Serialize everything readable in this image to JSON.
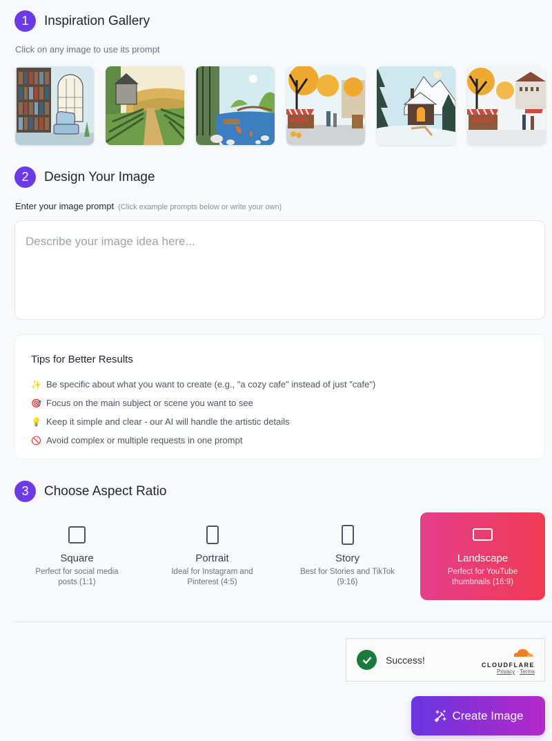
{
  "sections": {
    "gallery": {
      "step": "1",
      "title": "Inspiration Gallery",
      "hint": "Click on any image to use its prompt"
    },
    "design": {
      "step": "2",
      "title": "Design Your Image"
    },
    "aspect": {
      "step": "3",
      "title": "Choose Aspect Ratio"
    }
  },
  "gallery": {
    "images": [
      {
        "name": "library-reading-nook",
        "alt": "Cozy library with arched window and armchair"
      },
      {
        "name": "vineyard-cottage",
        "alt": "Stone cottage beside vineyard rows and hills"
      },
      {
        "name": "koi-pond-garden",
        "alt": "Japanese garden with koi pond and bridge"
      },
      {
        "name": "autumn-market",
        "alt": "Autumn street market with produce stalls"
      },
      {
        "name": "snowy-cabin",
        "alt": "Snowy mountain cabin with glowing window"
      },
      {
        "name": "winter-market",
        "alt": "Town square market in late autumn"
      }
    ]
  },
  "prompt": {
    "label": "Enter your image prompt",
    "sublabel": "(Click example prompts below or write your own)",
    "placeholder": "Describe your image idea here...",
    "value": ""
  },
  "tips": {
    "title": "Tips for Better Results",
    "items": [
      {
        "icon": "sparkles-icon",
        "glyph": "✨",
        "text": "Be specific about what you want to create (e.g., \"a cozy cafe\" instead of just \"cafe\")"
      },
      {
        "icon": "target-icon",
        "glyph": "🎯",
        "text": "Focus on the main subject or scene you want to see"
      },
      {
        "icon": "lightbulb-icon",
        "glyph": "💡",
        "text": "Keep it simple and clear - our AI will handle the artistic details"
      },
      {
        "icon": "prohibited-icon",
        "glyph": "🚫",
        "text": "Avoid complex or multiple requests in one prompt"
      }
    ]
  },
  "aspect_ratios": {
    "selected": "landscape",
    "options": [
      {
        "id": "square",
        "name": "Square",
        "desc": "Perfect for social media posts (1:1)"
      },
      {
        "id": "portrait",
        "name": "Portrait",
        "desc": "Ideal for Instagram and Pinterest (4:5)"
      },
      {
        "id": "story",
        "name": "Story",
        "desc": "Best for Stories and TikTok (9:16)"
      },
      {
        "id": "landscape",
        "name": "Landscape",
        "desc": "Perfect for YouTube thumbnails (16:9)"
      }
    ]
  },
  "captcha": {
    "status": "Success!",
    "brand": "CLOUDFLARE",
    "privacy": "Privacy",
    "separator": "·",
    "terms": "Terms"
  },
  "actions": {
    "create_label": "Create Image"
  },
  "colors": {
    "accent": "#6d3be6",
    "selected_gradient_start": "#e53f8c",
    "selected_gradient_end": "#ef3a52",
    "button_gradient_start": "#6a35e0",
    "button_gradient_end": "#b529c9",
    "success": "#1a7a3a",
    "cloudflare_orange": "#f38020"
  }
}
